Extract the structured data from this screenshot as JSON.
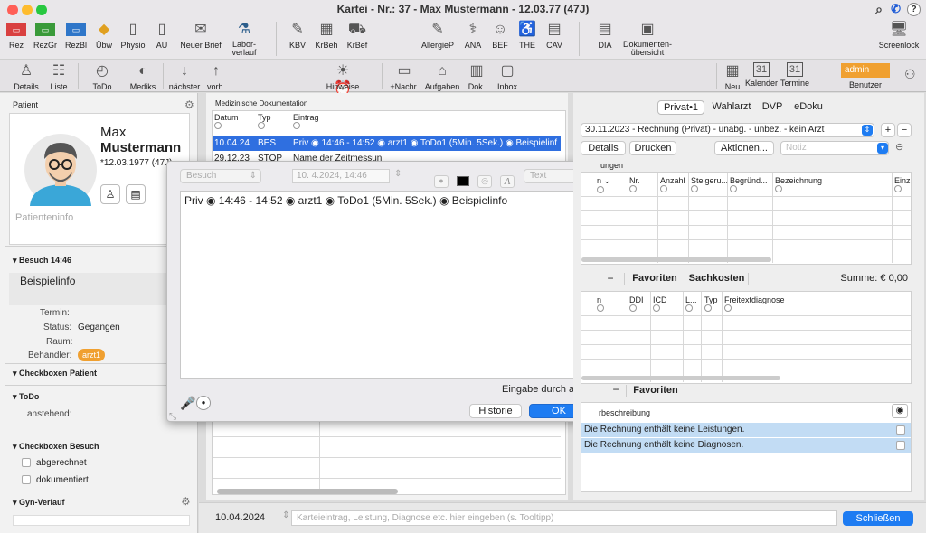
{
  "window": {
    "title": "Kartei - Nr.: 37 - Max Mustermann - 12.03.77 (47J)"
  },
  "toolbar1": {
    "items": [
      {
        "label": "Rez",
        "icon": "prescription-icon"
      },
      {
        "label": "RezGr",
        "icon": "prescription-green-icon"
      },
      {
        "label": "RezBl",
        "icon": "prescription-blue-icon"
      },
      {
        "label": "Übw",
        "icon": "referral-icon"
      },
      {
        "label": "Physio",
        "icon": "physio-doc-icon"
      },
      {
        "label": "AU",
        "icon": "au-doc-icon"
      },
      {
        "label": "Neuer Brief",
        "icon": "new-letter-icon"
      },
      {
        "label": "Labor-verlauf",
        "icon": "lab-flask-icon"
      },
      {
        "label": "KBV",
        "icon": "kbv-icon"
      },
      {
        "label": "KrBeh",
        "icon": "hospital-icon"
      },
      {
        "label": "KrBef",
        "icon": "ambulance-icon"
      },
      {
        "label": "AllergieP",
        "icon": "allergy-icon"
      },
      {
        "label": "ANA",
        "icon": "stethoscope-icon"
      },
      {
        "label": "BEF",
        "icon": "doctor-icon"
      },
      {
        "label": "THE",
        "icon": "therapy-icon"
      },
      {
        "label": "CAV",
        "icon": "cav-icon"
      },
      {
        "label": "DIA",
        "icon": "diagnosis-icon"
      },
      {
        "label": "Dokumenten-übersicht",
        "icon": "documents-overview-icon"
      },
      {
        "label": "Screenlock",
        "icon": "screenlock-icon"
      }
    ]
  },
  "toolbar2": {
    "items": [
      {
        "label": "Details",
        "icon": "person-icon"
      },
      {
        "label": "Liste",
        "icon": "people-list-icon"
      },
      {
        "label": "ToDo",
        "icon": "back-circle-icon"
      },
      {
        "label": "Mediks",
        "icon": "pill-icon"
      },
      {
        "label": "nächster",
        "icon": "arrow-down-icon"
      },
      {
        "label": "vorh.",
        "icon": "arrow-up-icon"
      },
      {
        "label": "Hinweise",
        "icon": "hints-icon"
      },
      {
        "label": "+Nachr.",
        "icon": "message-icon"
      },
      {
        "label": "Aufgaben",
        "icon": "tasks-icon"
      },
      {
        "label": "Dok.",
        "icon": "book-icon"
      },
      {
        "label": "Inbox",
        "icon": "inbox-icon"
      },
      {
        "label": "Neu",
        "icon": "calendar-new-icon"
      },
      {
        "label": "Kalender",
        "icon": "calendar-31-icon"
      },
      {
        "label": "Termine",
        "icon": "appointments-icon"
      },
      {
        "label": "Benutzer",
        "icon": "user-icon"
      }
    ],
    "user_badge": "admin"
  },
  "patient": {
    "section_label": "Patient",
    "first_name": "Max",
    "last_name": "Mustermann",
    "birth": "*12.03.1977 (47J)",
    "info_placeholder": "Patienteninfo"
  },
  "visit": {
    "title": "Besuch 14:46",
    "info": "Beispielinfo",
    "termin_label": "Termin:",
    "status_label": "Status:",
    "status_value": "Gegangen",
    "raum_label": "Raum:",
    "behandler_label": "Behandler:",
    "behandler_value": "arzt1"
  },
  "sections": {
    "checkboxen_patient": "Checkboxen Patient",
    "todo": "ToDo",
    "todo_sub": "anstehend:",
    "checkboxen_besuch": "Checkboxen Besuch",
    "abgerechnet": "abgerechnet",
    "dokumentiert": "dokumentiert",
    "gyn": "Gyn-Verlauf"
  },
  "med_doc": {
    "title": "Medizinische Dokumentation",
    "columns": [
      "Datum",
      "Typ",
      "Eintrag"
    ],
    "rows": [
      {
        "date": "10.04.24",
        "type": "BES",
        "entry": "Priv ◉ 14:46 - 14:52 ◉ arzt1 ◉ ToDo1 (5Min. 5Sek.) ◉ Beispielinf"
      },
      {
        "date": "29.12.23",
        "type": "STOP",
        "entry": "Name der Zeitmessun"
      }
    ]
  },
  "popup": {
    "type_select": "Besuch",
    "date_value": "10.  4.2024, 14:46",
    "text_select": "Text",
    "content": "Priv ◉ 14:46 - 14:52 ◉ arzt1 ◉ ToDo1 (5Min. 5Sek.) ◉ Beispielinfo",
    "footer": "Eingabe durch admin",
    "historie": "Historie",
    "ok": "OK"
  },
  "billing": {
    "tabs": [
      "Privat•1",
      "Wahlarzt",
      "DVP",
      "eDoku"
    ],
    "invoice_select": "30.11.2023 - Rechnung (Privat) - unabg. - unbez. - kein Arzt",
    "details": "Details",
    "drucken": "Drucken",
    "aktionen": "Aktionen...",
    "notiz_placeholder": "Notiz",
    "leistungen_label": "ungen",
    "cols1": [
      "n",
      "Nr.",
      "Anzahl",
      "Steigeru...",
      "Begründ...",
      "Bezeichnung",
      "Einz"
    ],
    "favoriten": "Favoriten",
    "sachkosten": "Sachkosten",
    "summe": "Summe: € 0,00",
    "cols2": [
      "n",
      "DDI",
      "ICD",
      "L...",
      "Typ",
      "Freitextdiagnose"
    ],
    "favoriten2": "Favoriten",
    "beschreibung": "rbeschreibung",
    "warn1": "Die Rechnung enthält keine Leistungen.",
    "warn2": "Die Rechnung enthält keine Diagnosen."
  },
  "bottom": {
    "date": "10.04.2024",
    "placeholder": "Karteieintrag, Leistung, Diagnose etc. hier eingeben (s. Tooltipp)",
    "schliessen": "Schließen"
  },
  "colors": {
    "accent": "#1e7cf2",
    "selection": "#2f6fe0",
    "badge": "#f0a030",
    "warn_bg": "#c2dcf4"
  }
}
